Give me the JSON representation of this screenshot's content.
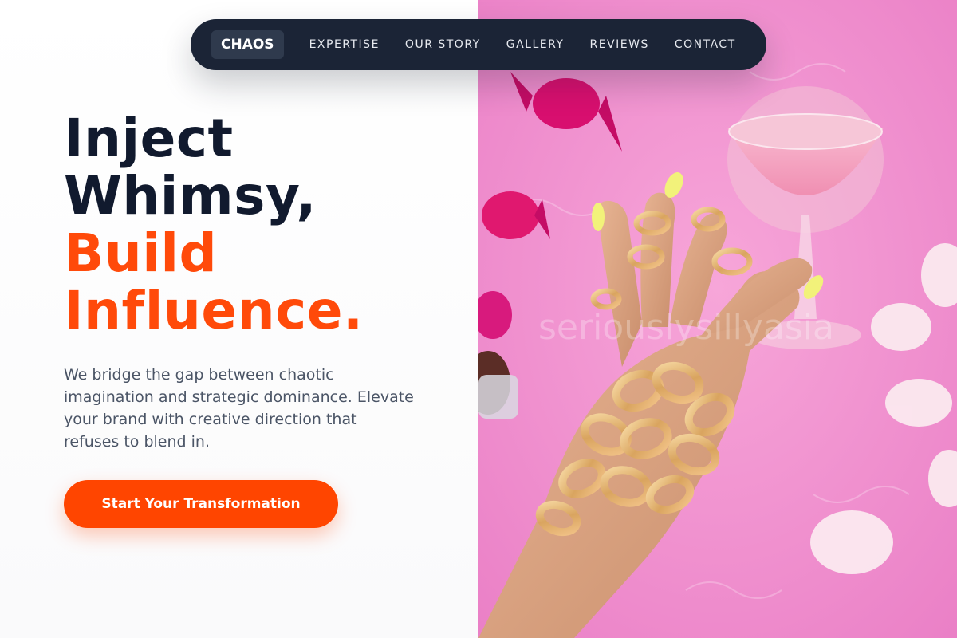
{
  "nav": {
    "logo": "CHAOS",
    "links": [
      "EXPERTISE",
      "OUR STORY",
      "GALLERY",
      "REVIEWS",
      "CONTACT"
    ]
  },
  "hero": {
    "headline_line1": "Inject",
    "headline_line2": "Whimsy,",
    "headline_line3": "Build",
    "headline_line4": "Influence.",
    "description": "We bridge the gap between chaotic imagination and strategic dominance. Elevate your brand with creative direction that refuses to blend in.",
    "cta_label": "Start Your Transformation"
  },
  "image": {
    "watermark": "seriouslysillyasia",
    "subject": "hand with gold chain bracelets and pink cocktail on pink fur"
  },
  "colors": {
    "accent": "#ff4500",
    "headline_dark": "#111a2e",
    "nav_bg": "#1b2436",
    "photo_pink": "#f48fd0"
  }
}
